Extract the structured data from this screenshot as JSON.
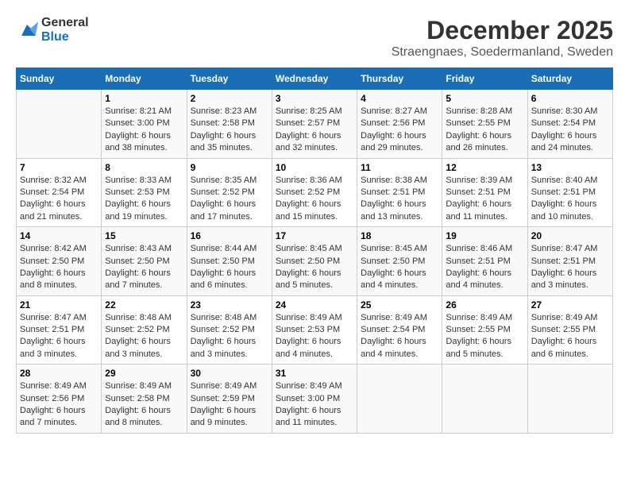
{
  "logo": {
    "line1": "General",
    "line2": "Blue"
  },
  "title": "December 2025",
  "location": "Straengnaes, Soedermanland, Sweden",
  "days_of_week": [
    "Sunday",
    "Monday",
    "Tuesday",
    "Wednesday",
    "Thursday",
    "Friday",
    "Saturday"
  ],
  "weeks": [
    [
      {
        "day": "",
        "info": ""
      },
      {
        "day": "1",
        "info": "Sunrise: 8:21 AM\nSunset: 3:00 PM\nDaylight: 6 hours\nand 38 minutes."
      },
      {
        "day": "2",
        "info": "Sunrise: 8:23 AM\nSunset: 2:58 PM\nDaylight: 6 hours\nand 35 minutes."
      },
      {
        "day": "3",
        "info": "Sunrise: 8:25 AM\nSunset: 2:57 PM\nDaylight: 6 hours\nand 32 minutes."
      },
      {
        "day": "4",
        "info": "Sunrise: 8:27 AM\nSunset: 2:56 PM\nDaylight: 6 hours\nand 29 minutes."
      },
      {
        "day": "5",
        "info": "Sunrise: 8:28 AM\nSunset: 2:55 PM\nDaylight: 6 hours\nand 26 minutes."
      },
      {
        "day": "6",
        "info": "Sunrise: 8:30 AM\nSunset: 2:54 PM\nDaylight: 6 hours\nand 24 minutes."
      }
    ],
    [
      {
        "day": "7",
        "info": "Sunrise: 8:32 AM\nSunset: 2:54 PM\nDaylight: 6 hours\nand 21 minutes."
      },
      {
        "day": "8",
        "info": "Sunrise: 8:33 AM\nSunset: 2:53 PM\nDaylight: 6 hours\nand 19 minutes."
      },
      {
        "day": "9",
        "info": "Sunrise: 8:35 AM\nSunset: 2:52 PM\nDaylight: 6 hours\nand 17 minutes."
      },
      {
        "day": "10",
        "info": "Sunrise: 8:36 AM\nSunset: 2:52 PM\nDaylight: 6 hours\nand 15 minutes."
      },
      {
        "day": "11",
        "info": "Sunrise: 8:38 AM\nSunset: 2:51 PM\nDaylight: 6 hours\nand 13 minutes."
      },
      {
        "day": "12",
        "info": "Sunrise: 8:39 AM\nSunset: 2:51 PM\nDaylight: 6 hours\nand 11 minutes."
      },
      {
        "day": "13",
        "info": "Sunrise: 8:40 AM\nSunset: 2:51 PM\nDaylight: 6 hours\nand 10 minutes."
      }
    ],
    [
      {
        "day": "14",
        "info": "Sunrise: 8:42 AM\nSunset: 2:50 PM\nDaylight: 6 hours\nand 8 minutes."
      },
      {
        "day": "15",
        "info": "Sunrise: 8:43 AM\nSunset: 2:50 PM\nDaylight: 6 hours\nand 7 minutes."
      },
      {
        "day": "16",
        "info": "Sunrise: 8:44 AM\nSunset: 2:50 PM\nDaylight: 6 hours\nand 6 minutes."
      },
      {
        "day": "17",
        "info": "Sunrise: 8:45 AM\nSunset: 2:50 PM\nDaylight: 6 hours\nand 5 minutes."
      },
      {
        "day": "18",
        "info": "Sunrise: 8:45 AM\nSunset: 2:50 PM\nDaylight: 6 hours\nand 4 minutes."
      },
      {
        "day": "19",
        "info": "Sunrise: 8:46 AM\nSunset: 2:51 PM\nDaylight: 6 hours\nand 4 minutes."
      },
      {
        "day": "20",
        "info": "Sunrise: 8:47 AM\nSunset: 2:51 PM\nDaylight: 6 hours\nand 3 minutes."
      }
    ],
    [
      {
        "day": "21",
        "info": "Sunrise: 8:47 AM\nSunset: 2:51 PM\nDaylight: 6 hours\nand 3 minutes."
      },
      {
        "day": "22",
        "info": "Sunrise: 8:48 AM\nSunset: 2:52 PM\nDaylight: 6 hours\nand 3 minutes."
      },
      {
        "day": "23",
        "info": "Sunrise: 8:48 AM\nSunset: 2:52 PM\nDaylight: 6 hours\nand 3 minutes."
      },
      {
        "day": "24",
        "info": "Sunrise: 8:49 AM\nSunset: 2:53 PM\nDaylight: 6 hours\nand 4 minutes."
      },
      {
        "day": "25",
        "info": "Sunrise: 8:49 AM\nSunset: 2:54 PM\nDaylight: 6 hours\nand 4 minutes."
      },
      {
        "day": "26",
        "info": "Sunrise: 8:49 AM\nSunset: 2:55 PM\nDaylight: 6 hours\nand 5 minutes."
      },
      {
        "day": "27",
        "info": "Sunrise: 8:49 AM\nSunset: 2:55 PM\nDaylight: 6 hours\nand 6 minutes."
      }
    ],
    [
      {
        "day": "28",
        "info": "Sunrise: 8:49 AM\nSunset: 2:56 PM\nDaylight: 6 hours\nand 7 minutes."
      },
      {
        "day": "29",
        "info": "Sunrise: 8:49 AM\nSunset: 2:58 PM\nDaylight: 6 hours\nand 8 minutes."
      },
      {
        "day": "30",
        "info": "Sunrise: 8:49 AM\nSunset: 2:59 PM\nDaylight: 6 hours\nand 9 minutes."
      },
      {
        "day": "31",
        "info": "Sunrise: 8:49 AM\nSunset: 3:00 PM\nDaylight: 6 hours\nand 11 minutes."
      },
      {
        "day": "",
        "info": ""
      },
      {
        "day": "",
        "info": ""
      },
      {
        "day": "",
        "info": ""
      }
    ]
  ]
}
